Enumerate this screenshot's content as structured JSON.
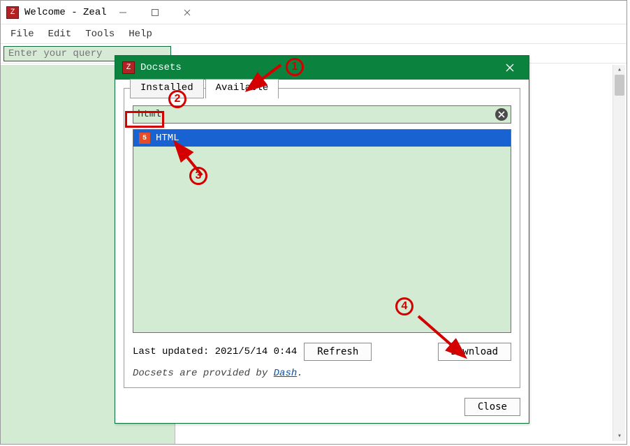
{
  "window": {
    "title": "Welcome - Zeal",
    "menu": {
      "file": "File",
      "edit": "Edit",
      "tools": "Tools",
      "help": "Help"
    },
    "search_placeholder": "Enter your query"
  },
  "dialog": {
    "title": "Docsets",
    "tabs": {
      "installed": "Installed",
      "available": "Available"
    },
    "search_value": "html",
    "results": [
      {
        "icon": "html5-icon",
        "label": "HTML"
      }
    ],
    "last_updated_label": "Last updated: 2021/5/14 0:44",
    "refresh_label": "Refresh",
    "download_label": "Download",
    "footnote_prefix": "Docsets are provided by ",
    "footnote_link": "Dash",
    "close_label": "Close"
  },
  "annotations": {
    "n1": "1",
    "n2": "2",
    "n3": "3",
    "n4": "4"
  }
}
